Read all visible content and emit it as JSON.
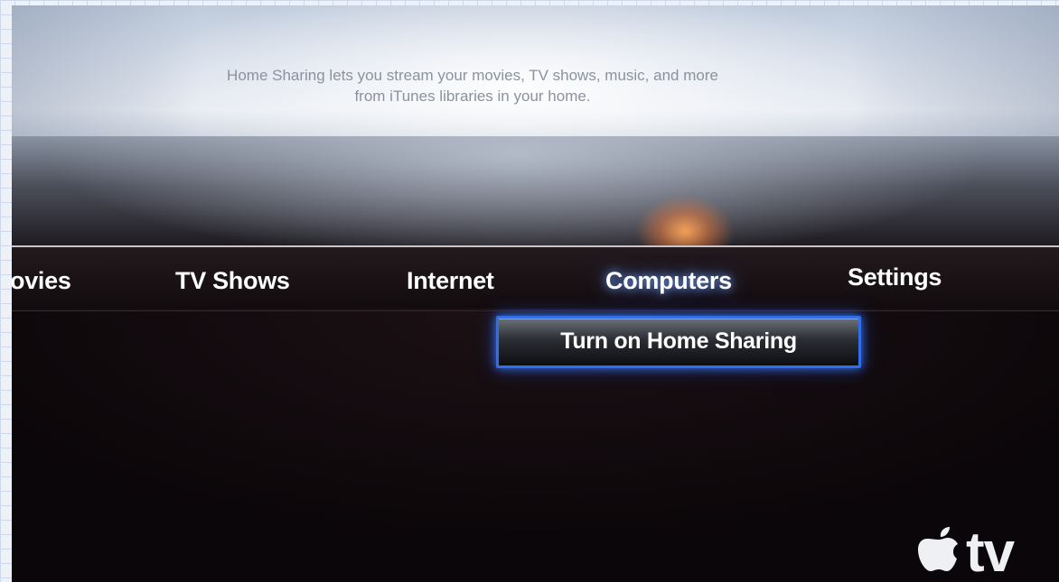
{
  "description": {
    "line1": "Home Sharing lets you stream your movies, TV shows, music, and more",
    "line2": "from iTunes libraries in your home."
  },
  "menu": {
    "items": [
      {
        "label": "ovies"
      },
      {
        "label": "TV Shows"
      },
      {
        "label": "Internet"
      },
      {
        "label": "Computers",
        "selected": true
      },
      {
        "label": "Settings"
      }
    ]
  },
  "submenu": {
    "button_label": "Turn on Home Sharing"
  },
  "logo": {
    "icon": "apple-logo-icon",
    "text": "tv"
  },
  "colors": {
    "focus_border": "#2f6fe8",
    "selection_glow": "#ffaa5a"
  }
}
